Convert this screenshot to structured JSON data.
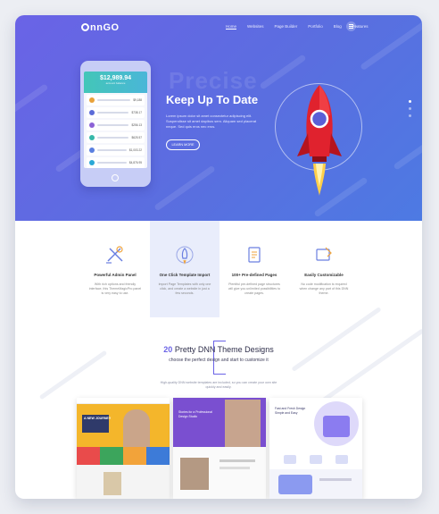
{
  "logo": {
    "text": "nnGO"
  },
  "nav": {
    "items": [
      "Home",
      "Websites",
      "Page Builder",
      "Portfolio",
      "Blog",
      "Features"
    ],
    "active": 0
  },
  "hero": {
    "title": "Keep Up To Date",
    "text": "Lorem ipsum dolor sit amet consectetur adipiscing elit. Suspendisse sit amet dapibus sem. Aliquam sed placerat neque. Sed quis eros nec eros.",
    "button": "LEARN MORE",
    "watermark": "Precise",
    "phone_balance": "$12,989.94",
    "phone_balance_sub": "account balance",
    "coins": [
      {
        "price": "$9,188",
        "color": "#e8a13a"
      },
      {
        "price": "$738.17",
        "color": "#5b6bd8"
      },
      {
        "price": "$256.13",
        "color": "#8c62d6"
      },
      {
        "price": "$625.57",
        "color": "#37b8a9"
      },
      {
        "price": "$1,003.22",
        "color": "#5a7fe0"
      },
      {
        "price": "$4,876.95",
        "color": "#2aa8d6"
      }
    ]
  },
  "features": [
    {
      "title": "Powerful Admin Panel",
      "desc": "With rich options and friendly interface, this ThemeMagicPro panel is very easy to use."
    },
    {
      "title": "One Click Template Import",
      "desc": "Import Page Templates with only one click, and create a website in just a few seconds."
    },
    {
      "title": "100+ Pre-defined Pages",
      "desc": "Plentiful pre-defined page structures will give you unlimited possibilities to create pages."
    },
    {
      "title": "Easily Customizable",
      "desc": "No code modification is required when change any part of this DNN theme."
    }
  ],
  "features_active": 1,
  "designs": {
    "title_number": "20",
    "title_rest": "Pretty DNN Theme Designs",
    "subtitle": "choose the perfect design and start to customize it",
    "desc": "High-quality DNN website templates are included, so you can create your own site quickly and easily.",
    "shot_texts": [
      "A NEW JOURNEY",
      "Stories for a Professional Design Studio",
      "Fast and Fresh Design Simple and Easy"
    ]
  },
  "colors": {
    "accent": "#6a63e6",
    "hero_from": "#6a63e6",
    "hero_to": "#4d7ae3",
    "rocket": "#e0222e"
  }
}
